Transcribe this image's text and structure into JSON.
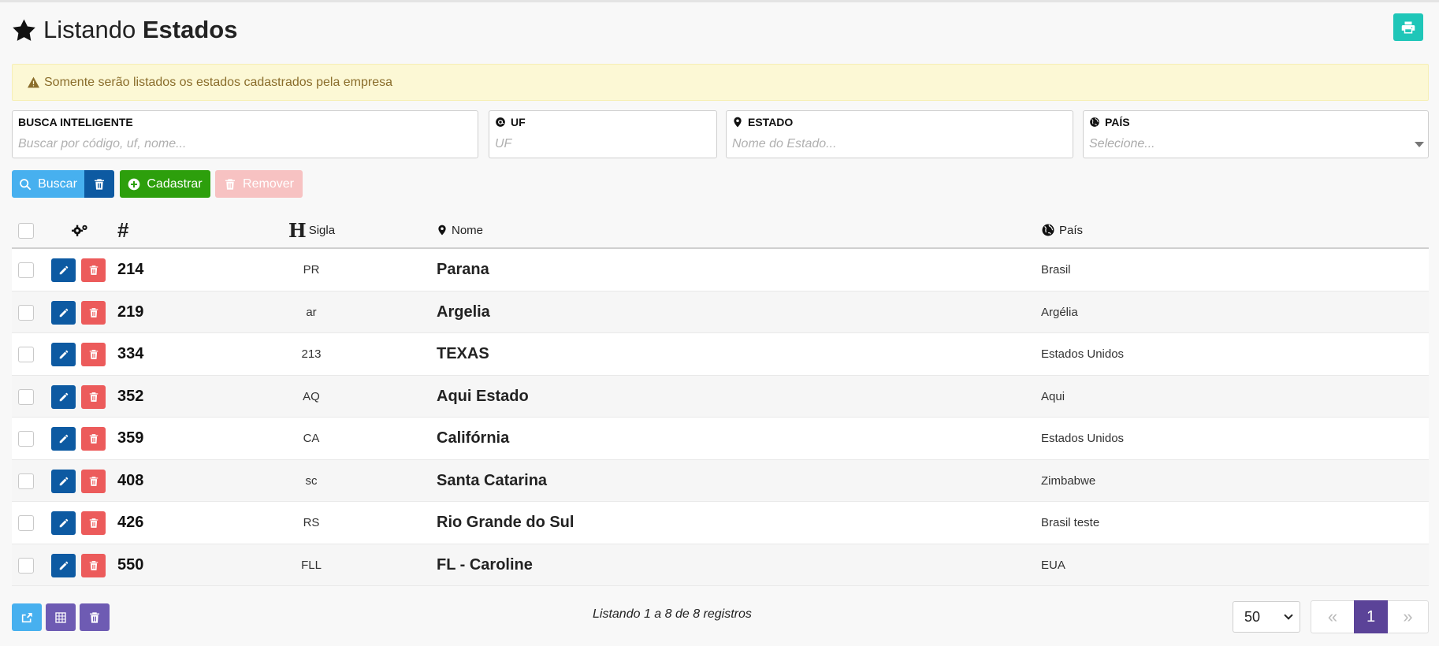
{
  "header": {
    "title_light": "Listando",
    "title_bold": "Estados",
    "icon": "star-icon",
    "print_icon": "print-icon"
  },
  "alert": {
    "text": "Somente serão listados os estados cadastrados pela empresa",
    "icon": "warning-icon"
  },
  "filters": {
    "smart": {
      "label": "BUSCA INTELIGENTE",
      "placeholder": "Buscar por código, uf, nome..."
    },
    "uf": {
      "label": "UF",
      "placeholder": "UF",
      "icon": "at-icon"
    },
    "estado": {
      "label": "ESTADO",
      "placeholder": "Nome do Estado...",
      "icon": "map-marker-icon"
    },
    "pais": {
      "label": "PAÍS",
      "placeholder": "Selecione...",
      "icon": "globe-icon"
    }
  },
  "actions": {
    "search_label": "Buscar",
    "register_label": "Cadastrar",
    "remove_label": "Remover"
  },
  "table": {
    "columns": {
      "id": "#",
      "sigla": "Sigla",
      "nome": "Nome",
      "pais": "País"
    },
    "rows": [
      {
        "id": "214",
        "sigla": "PR",
        "nome": "Parana",
        "pais": "Brasil"
      },
      {
        "id": "219",
        "sigla": "ar",
        "nome": "Argelia",
        "pais": "Argélia"
      },
      {
        "id": "334",
        "sigla": "213",
        "nome": "TEXAS",
        "pais": "Estados Unidos"
      },
      {
        "id": "352",
        "sigla": "AQ",
        "nome": "Aqui Estado",
        "pais": "Aqui"
      },
      {
        "id": "359",
        "sigla": "CA",
        "nome": "Califórnia",
        "pais": "Estados Unidos"
      },
      {
        "id": "408",
        "sigla": "sc",
        "nome": "Santa Catarina",
        "pais": "Zimbabwe"
      },
      {
        "id": "426",
        "sigla": "RS",
        "nome": "Rio Grande do Sul",
        "pais": "Brasil teste"
      },
      {
        "id": "550",
        "sigla": "FLL",
        "nome": "FL - Caroline",
        "pais": "EUA"
      }
    ]
  },
  "footer": {
    "listing_text": "Listando 1 a 8 de 8 registros",
    "page_size": "50",
    "first_label": "«",
    "current_page": "1",
    "last_label": "»"
  },
  "colors": {
    "primary": "#0d5aa2",
    "info": "#47b0ef",
    "success": "#2d9f0c",
    "danger": "#ec5b5b",
    "purple": "#6e5bb3",
    "teal": "#1fc6b8"
  }
}
